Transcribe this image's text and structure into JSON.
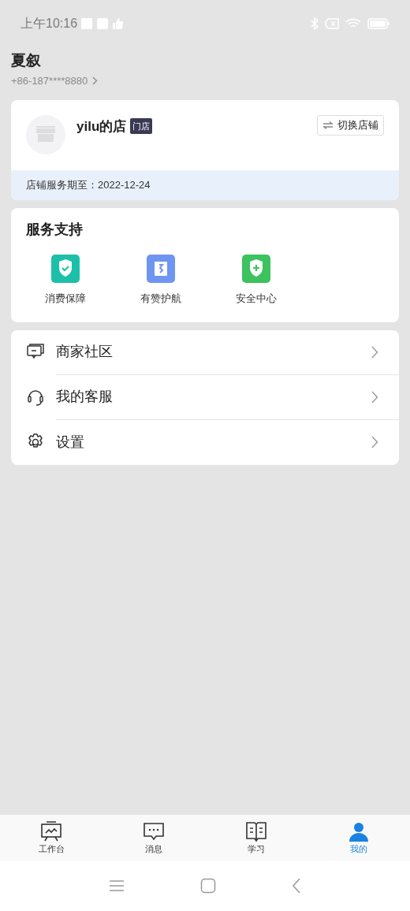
{
  "status_bar": {
    "time": "上午10:16"
  },
  "profile": {
    "name": "夏叙",
    "phone": "+86-187****8880"
  },
  "shop": {
    "name": "yilu的店",
    "tag": "门店",
    "switch_button": "切换店铺",
    "expiry": "店铺服务期至：2022-12-24"
  },
  "services": {
    "title": "服务支持",
    "items": [
      {
        "label": "消费保障",
        "kind": "check-shield",
        "color": "#1cc0a8"
      },
      {
        "label": "有赞护航",
        "kind": "card",
        "color": "#6f95f2"
      },
      {
        "label": "安全中心",
        "kind": "plus-shield",
        "color": "#3cc25e"
      }
    ]
  },
  "menu": [
    {
      "label": "商家社区",
      "kind": "community"
    },
    {
      "label": "我的客服",
      "kind": "headset"
    },
    {
      "label": "设置",
      "kind": "gear"
    }
  ],
  "tabs": [
    {
      "label": "工作台",
      "kind": "board",
      "selected": false
    },
    {
      "label": "消息",
      "kind": "message",
      "selected": false
    },
    {
      "label": "学习",
      "kind": "book",
      "selected": false
    },
    {
      "label": "我的",
      "kind": "person",
      "selected": true
    }
  ]
}
